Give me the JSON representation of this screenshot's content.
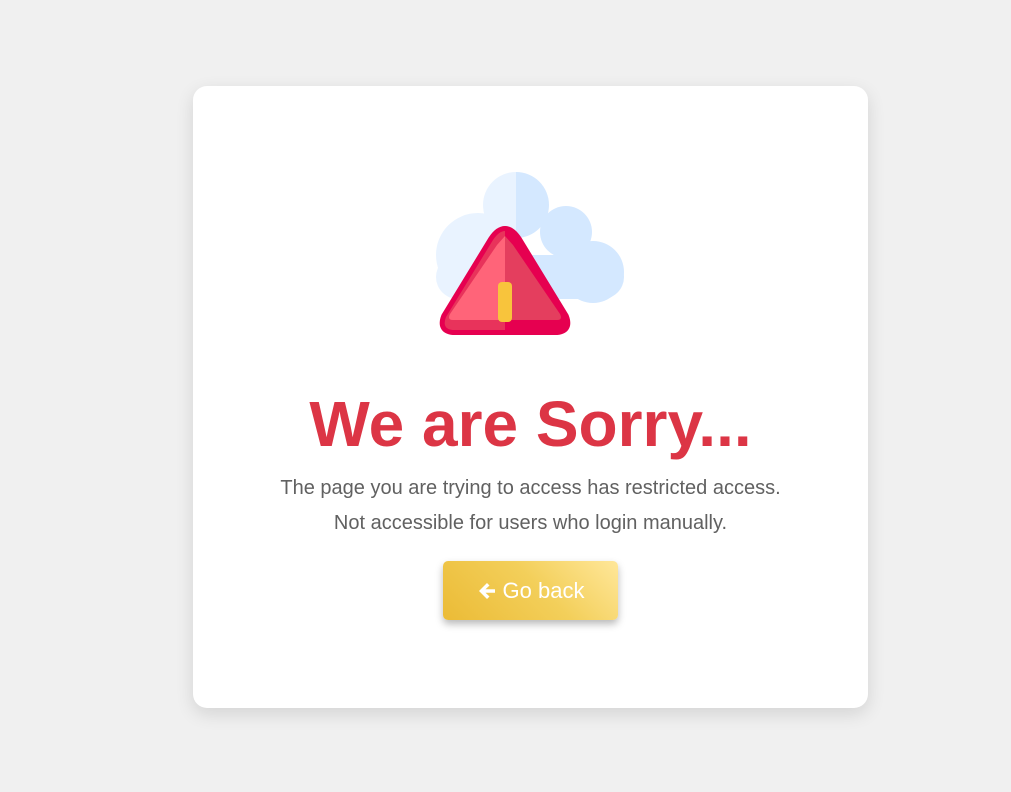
{
  "page": {
    "background_color": "#f0f0f0"
  },
  "card": {
    "illustration": {
      "icon": "warning-triangle-with-cloud-icon",
      "colors": {
        "cloud_light": "#e9f3ff",
        "cloud_dark": "#d4e8ff",
        "triangle_outer": "#e60050",
        "triangle_inner": "#ff6479",
        "exclamation": "#f8c43c"
      }
    },
    "title": "We are Sorry...",
    "title_color": "#dc3545",
    "message_line1": "The page you are trying to access has restricted access.",
    "message_line2": "Not accessible for users who login manually.",
    "go_back_button": {
      "label": "Go back",
      "icon": "arrow-left-icon",
      "color": "#f3cf5a"
    }
  }
}
